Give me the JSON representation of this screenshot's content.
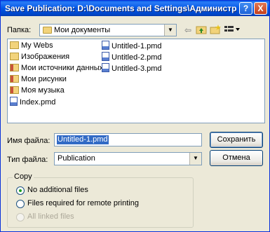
{
  "window": {
    "title": "Save Publication: D:\\Documents and Settings\\Администр..."
  },
  "titlebar": {
    "help_label": "?",
    "close_label": "X"
  },
  "folder": {
    "label": "Папка:",
    "value": "Мои документы",
    "toolbar_icons": [
      "back-arrow-icon",
      "up-folder-icon",
      "new-folder-icon",
      "view-menu-icon"
    ]
  },
  "files": {
    "col1": [
      {
        "name": "My Webs",
        "icon": "folder-icon"
      },
      {
        "name": "Изображения",
        "icon": "folder-icon"
      },
      {
        "name": "Мои источники данных",
        "icon": "folder-icon"
      },
      {
        "name": "Мои рисунки",
        "icon": "folder-icon"
      },
      {
        "name": "Моя музыка",
        "icon": "folder-icon"
      },
      {
        "name": "Index.pmd",
        "icon": "pmd-file-icon"
      }
    ],
    "col2": [
      {
        "name": "Untitled-1.pmd",
        "icon": "pmd-file-icon"
      },
      {
        "name": "Untitled-2.pmd",
        "icon": "pmd-file-icon"
      },
      {
        "name": "Untitled-3.pmd",
        "icon": "pmd-file-icon"
      }
    ]
  },
  "filename": {
    "label": "Имя файла:",
    "value": "Untitled-1.pmd"
  },
  "filetype": {
    "label": "Тип файла:",
    "value": "Publication"
  },
  "buttons": {
    "save": "Сохранить",
    "cancel": "Отмена"
  },
  "copy_group": {
    "title": "Copy",
    "options": [
      {
        "label": "No additional files",
        "checked": true,
        "disabled": false
      },
      {
        "label": "Files required for remote printing",
        "checked": false,
        "disabled": false
      },
      {
        "label": "All linked files",
        "checked": false,
        "disabled": true
      }
    ]
  }
}
